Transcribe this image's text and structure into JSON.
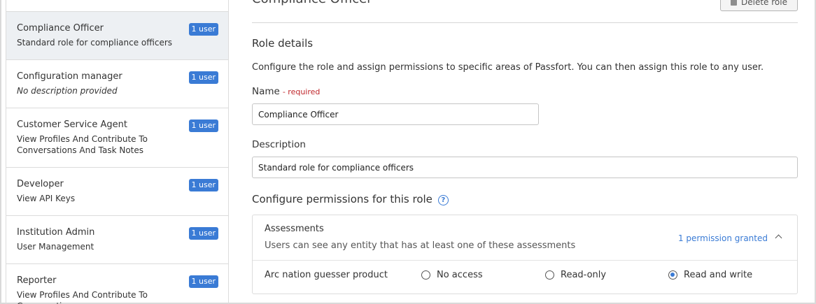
{
  "sidebar": {
    "roles": [
      {
        "name": "Compliance Officer",
        "description": "Standard role for compliance officers",
        "users": "1 user"
      },
      {
        "name": "Configuration manager",
        "description": "No description provided",
        "users": "1 user"
      },
      {
        "name": "Customer Service Agent",
        "description": "View Profiles And Contribute To Conversations And Task Notes",
        "users": "1 user"
      },
      {
        "name": "Developer",
        "description": "View API Keys",
        "users": "1 user"
      },
      {
        "name": "Institution Admin",
        "description": "User Management",
        "users": "1 user"
      },
      {
        "name": "Reporter",
        "description": "View Profiles And Contribute To Conversations",
        "users": "1 user"
      }
    ]
  },
  "main": {
    "title": "Compliance Officer",
    "delete_label": "Delete role",
    "role_details_heading": "Role details",
    "intro": "Configure the role and assign permissions to specific areas of Passfort. You can then assign this role to any user.",
    "name_label": "Name",
    "name_required": "- required",
    "name_value": "Compliance Officer",
    "description_label": "Description",
    "description_value": "Standard role for compliance officers",
    "permissions_heading": "Configure permissions for this role",
    "help_icon": "?",
    "permissions": {
      "title": "Assessments",
      "subtitle": "Users can see any entity that has at least one of these assessments",
      "granted": "1 permission granted",
      "row_label": "Arc nation guesser product",
      "options": [
        "No access",
        "Read-only",
        "Read and write"
      ],
      "selected": "Read and write"
    }
  },
  "colors": {
    "accent": "#3a7bd5",
    "required": "#c0282d",
    "active_row": "#edf0f3"
  }
}
